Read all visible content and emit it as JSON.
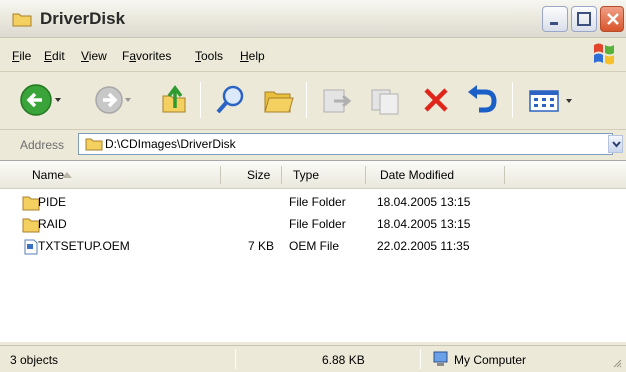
{
  "window": {
    "title": "DriverDisk"
  },
  "menu": [
    "File",
    "Edit",
    "View",
    "Favorites",
    "Tools",
    "Help"
  ],
  "menu_underline": [
    "F",
    "E",
    "V",
    "a",
    "T",
    "H"
  ],
  "address": {
    "label": "Address",
    "value": "D:\\CDImages\\DriverDisk"
  },
  "columns": {
    "name": "Name",
    "size": "Size",
    "type": "Type",
    "date": "Date Modified"
  },
  "files": [
    {
      "name": "PIDE",
      "size": "",
      "type": "File Folder",
      "date": "18.04.2005 13:15",
      "icon": "folder-icon"
    },
    {
      "name": "RAID",
      "size": "",
      "type": "File Folder",
      "date": "18.04.2005 13:15",
      "icon": "folder-icon"
    },
    {
      "name": "TXTSETUP.OEM",
      "size": "7 KB",
      "type": "OEM File",
      "date": "22.02.2005 11:35",
      "icon": "document-icon"
    }
  ],
  "status": {
    "objects": "3 objects",
    "size": "6.88 KB",
    "location": "My Computer"
  },
  "colors": {
    "folder": "#f3d060",
    "back_green": "#3aa33a",
    "close_red": "#d8552c",
    "delete_red": "#e0261b",
    "undo_blue": "#1a5fc7"
  }
}
